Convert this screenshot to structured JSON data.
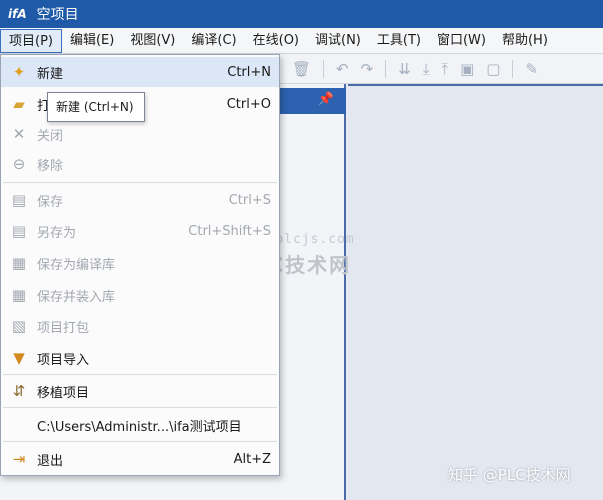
{
  "window": {
    "logo": "ifA",
    "title": "空项目"
  },
  "menubar": [
    "项目(P)",
    "编辑(E)",
    "视图(V)",
    "编译(C)",
    "在线(O)",
    "调试(N)",
    "工具(T)",
    "窗口(W)",
    "帮助(H)"
  ],
  "project_menu": {
    "items": [
      {
        "label": "新建",
        "shortcut": "Ctrl+N",
        "enabled": true,
        "icon": "new-file-icon"
      },
      {
        "label": "打开",
        "shortcut": "Ctrl+O",
        "enabled": true,
        "icon": "folder-open-icon"
      },
      {
        "label": "关闭",
        "shortcut": "",
        "enabled": false,
        "icon": "close-icon"
      },
      {
        "label": "移除",
        "shortcut": "",
        "enabled": false,
        "icon": "remove-icon"
      },
      {
        "label": "保存",
        "shortcut": "Ctrl+S",
        "enabled": false,
        "icon": "save-icon"
      },
      {
        "label": "另存为",
        "shortcut": "Ctrl+Shift+S",
        "enabled": false,
        "icon": "save-as-icon"
      },
      {
        "label": "保存为编译库",
        "shortcut": "",
        "enabled": false,
        "icon": "save-library-icon"
      },
      {
        "label": "保存并装入库",
        "shortcut": "",
        "enabled": false,
        "icon": "save-install-library-icon"
      },
      {
        "label": "项目打包",
        "shortcut": "",
        "enabled": false,
        "icon": "package-icon"
      },
      {
        "label": "项目导入",
        "shortcut": "",
        "enabled": true,
        "icon": "import-icon"
      },
      {
        "label": "移植项目",
        "shortcut": "",
        "enabled": true,
        "icon": "migrate-icon"
      },
      {
        "label": "C:\\Users\\Administr...\\ifa测试项目",
        "shortcut": "",
        "enabled": true,
        "icon": ""
      },
      {
        "label": "退出",
        "shortcut": "Alt+Z",
        "enabled": true,
        "icon": "exit-icon"
      }
    ]
  },
  "tooltip": "新建 (Ctrl+N)",
  "watermark": {
    "url": "www.plcjs.com",
    "brand": "PLC技术网",
    "credit": "知乎 @PLC技术网"
  }
}
